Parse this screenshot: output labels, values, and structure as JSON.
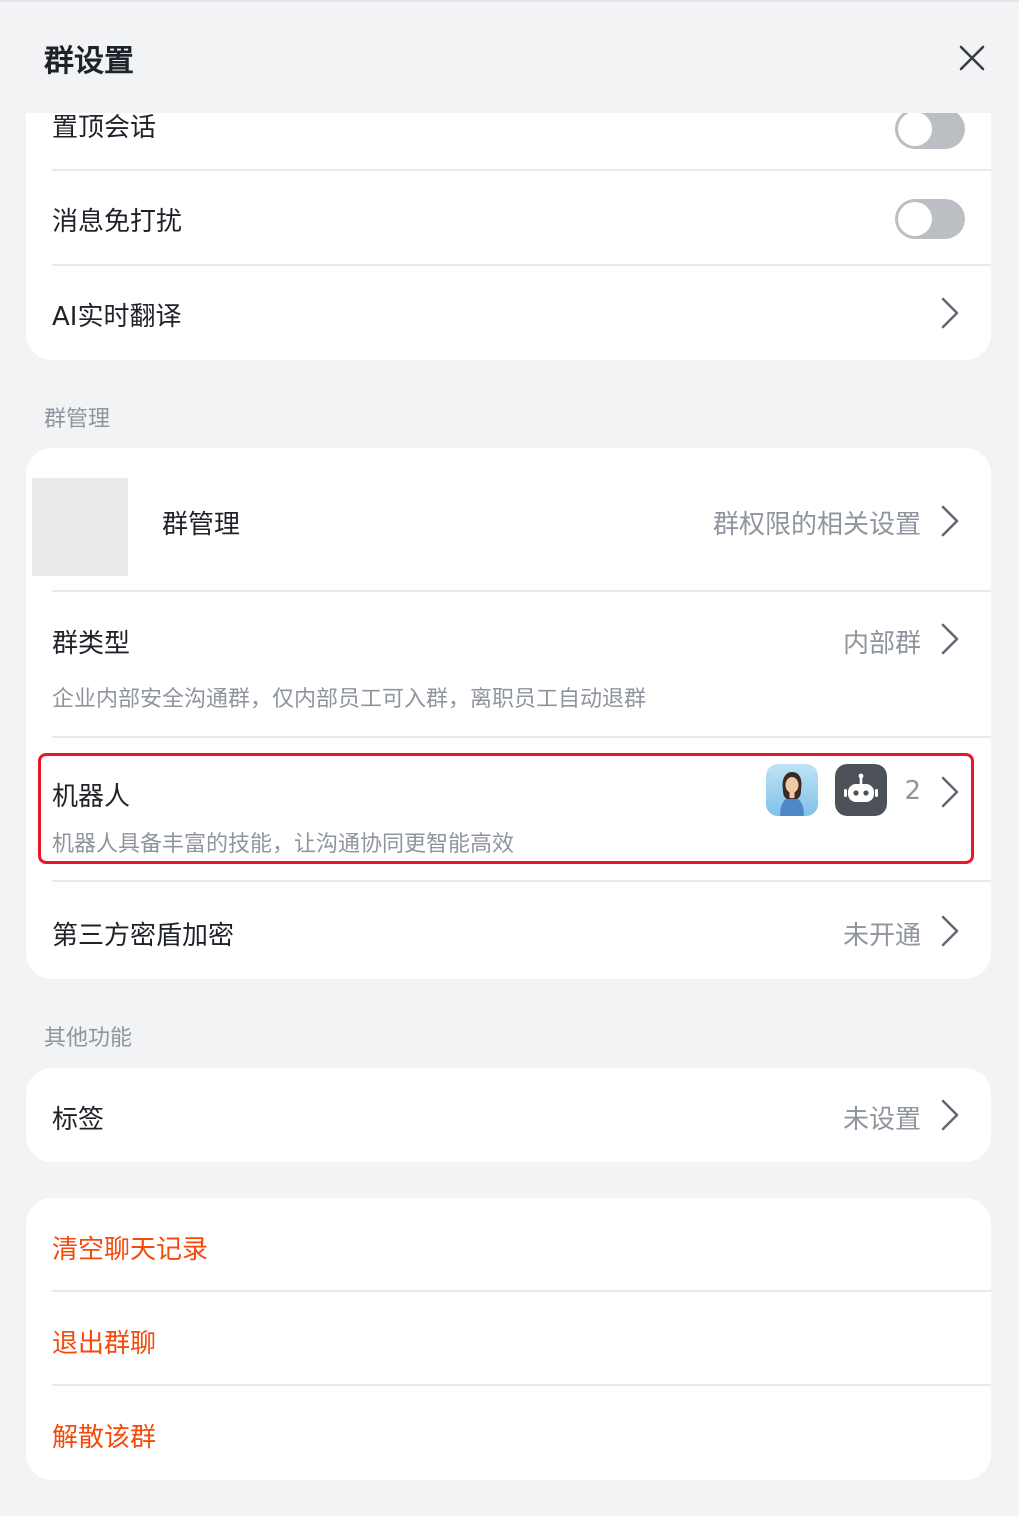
{
  "header": {
    "title": "群设置",
    "close_icon": "close-icon"
  },
  "settings_card": {
    "items": [
      {
        "label": "置顶会话",
        "toggle_on": false
      },
      {
        "label": "消息免打扰",
        "toggle_on": false
      },
      {
        "label": "AI实时翻译"
      }
    ]
  },
  "group_management": {
    "section_title": "群管理",
    "manage": {
      "label": "群管理",
      "value": "群权限的相关设置"
    },
    "group_type": {
      "label": "群类型",
      "value": "内部群",
      "desc": "企业内部安全沟通群，仅内部员工可入群，离职员工自动退群"
    },
    "robots": {
      "label": "机器人",
      "desc": "机器人具备丰富的技能，让沟通协同更智能高效",
      "count": "2",
      "icons": [
        "person-avatar-icon",
        "robot-icon"
      ]
    },
    "encryption": {
      "label": "第三方密盾加密",
      "value": "未开通"
    }
  },
  "other": {
    "section_title": "其他功能",
    "tags": {
      "label": "标签",
      "value": "未设置"
    }
  },
  "danger_actions": {
    "clear_history": "清空聊天记录",
    "leave_group": "退出群聊",
    "dissolve_group": "解散该群"
  },
  "colors": {
    "background": "#f2f3f5",
    "card": "#ffffff",
    "danger": "#f54a0a",
    "highlight": "#e8172b",
    "secondary_text": "#8f959e"
  }
}
